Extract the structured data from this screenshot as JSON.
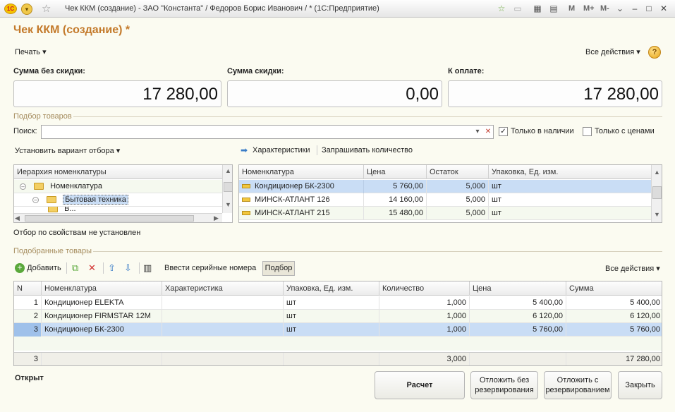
{
  "window": {
    "title": "Чек ККМ (создание) - ЗАО \"Константа\" / Федоров Борис Иванович / * (1С:Предприятие)",
    "logo": "1С",
    "tb_m1": "M",
    "tb_m2": "M+",
    "tb_m3": "M-"
  },
  "form": {
    "title": "Чек ККМ (создание) *",
    "print_menu": "Печать ▾",
    "all_actions": "Все действия ▾",
    "help": "?"
  },
  "sums": {
    "no_discount_label": "Сумма без скидки:",
    "no_discount_value": "17 280,00",
    "discount_label": "Сумма скидки:",
    "discount_value": "0,00",
    "to_pay_label": "К оплате:",
    "to_pay_value": "17 280,00"
  },
  "selection": {
    "section_title": "Подбор товаров",
    "search_label": "Поиск:",
    "search_value": "",
    "only_in_stock_label": "Только в наличии",
    "only_in_stock_checked": true,
    "only_with_prices_label": "Только с ценами",
    "only_with_prices_checked": false,
    "filter_variant": "Установить вариант отбора ▾",
    "characteristics_link": "Характеристики",
    "ask_quantity_link": "Запрашивать количество",
    "no_property_filter": "Отбор по свойствам не установлен"
  },
  "hierarchy": {
    "header": "Иерархия номенклатуры",
    "items": [
      {
        "label": "Номенклатура"
      },
      {
        "label": "Бытовая техника"
      },
      {
        "label": "В..."
      }
    ]
  },
  "catalog": {
    "columns": [
      "Номенклатура",
      "Цена",
      "Остаток",
      "Упаковка, Ед. изм."
    ],
    "rows": [
      {
        "name": "Кондиционер БК-2300",
        "price": "5 760,00",
        "stock": "5,000",
        "unit": "шт"
      },
      {
        "name": "МИНСК-АТЛАНТ 126",
        "price": "14 160,00",
        "stock": "5,000",
        "unit": "шт"
      },
      {
        "name": "МИНСК-АТЛАНТ 215",
        "price": "15 480,00",
        "stock": "5,000",
        "unit": "шт"
      }
    ]
  },
  "selected": {
    "section_title": "Подобранные товары",
    "add_label": "Добавить",
    "serials_label": "Ввести серийные номера",
    "pick_label": "Подбор",
    "all_actions": "Все действия ▾",
    "columns": [
      "N",
      "Номенклатура",
      "Характеристика",
      "Упаковка, Ед. изм.",
      "Количество",
      "Цена",
      "Сумма"
    ],
    "rows": [
      {
        "n": "1",
        "name": "Кондиционер ELEKTA",
        "char": "",
        "unit": "шт",
        "qty": "1,000",
        "price": "5 400,00",
        "sum": "5 400,00"
      },
      {
        "n": "2",
        "name": "Кондиционер FIRMSTAR 12M",
        "char": "",
        "unit": "шт",
        "qty": "1,000",
        "price": "6 120,00",
        "sum": "6 120,00"
      },
      {
        "n": "3",
        "name": "Кондиционер БК-2300",
        "char": "",
        "unit": "шт",
        "qty": "1,000",
        "price": "5 760,00",
        "sum": "5 760,00"
      }
    ],
    "footer": {
      "n": "3",
      "qty": "3,000",
      "sum": "17 280,00"
    }
  },
  "bottom": {
    "status": "Открыт",
    "calc": "Расчет",
    "postpone_no_reserve": "Отложить без резервирования",
    "postpone_reserve": "Отложить с резервированием",
    "close": "Закрыть"
  },
  "colors": {
    "accent_title": "#c3792a",
    "selection_row": "#c9ddf5",
    "background": "#fbfbf1"
  }
}
